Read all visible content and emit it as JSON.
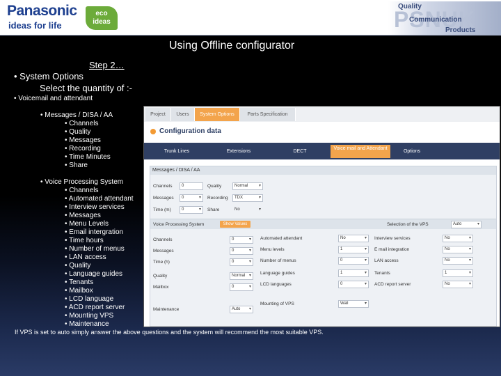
{
  "header": {
    "brand": "Panasonic",
    "tagline": "ideas for life",
    "eco_line1": "eco",
    "eco_line2": "ideas",
    "psnuk": "PSNUK",
    "quality": "Quality",
    "communication": "Communication",
    "products": "Products"
  },
  "title": "Using Offline configurator",
  "step": "Step 2…",
  "system_options": "• System Options",
  "select_quantity": "Select the quantity of :-",
  "voicemail_bullet": "•   Voicemail and attendant",
  "messages_bullet": "•   Messages / DISA / AA",
  "messages_items": [
    "Channels",
    "Quality",
    "Messages",
    "Recording",
    "Time Minutes",
    "Share"
  ],
  "vps_bullet": "•   Voice Processing System",
  "vps_items": [
    "Channels",
    "Automated attendant",
    "Interview services",
    "Messages",
    "Menu Levels",
    "Email intergration",
    "Time hours",
    "Number of menus",
    "LAN access",
    "Quality",
    "Language guides",
    "Tenants",
    "Mailbox",
    "LCD language",
    "ACD report server",
    "Mounting VPS",
    "Maintenance"
  ],
  "footer": "If VPS is set to auto simply answer the above questions and the system will recommend the most  suitable VPS.",
  "screenshot": {
    "tabs": [
      "Project",
      "Users",
      "System Options",
      "Parts Specification"
    ],
    "config_title": "Configuration data",
    "subtabs": [
      "Trunk Lines",
      "Extensions",
      "DECT",
      "Voice mail and Attendant",
      "Options"
    ],
    "msg_section": "Messages / DISA / AA",
    "msg_fields": {
      "channels_label": "Channels",
      "channels_value": "0",
      "quality_label": "Quality",
      "quality_value": "Normal",
      "messages_label": "Messages",
      "messages_value": "0",
      "recording_label": "Recording",
      "recording_value": "TDX",
      "time_label": "Time (m)",
      "time_value": "0",
      "share_label": "Share",
      "share_value": "No"
    },
    "vps_section": "Voice Processing System",
    "vps_button": "Show Values",
    "selection_label": "Selection of the VPS",
    "selection_value": "Auto",
    "vps_left": [
      {
        "label": "Channels",
        "value": "0"
      },
      {
        "label": "Messages",
        "value": "0"
      },
      {
        "label": "Time (h)",
        "value": "0"
      },
      {
        "label": "Quality",
        "value": "Normal"
      },
      {
        "label": "Mailbox",
        "value": "0"
      },
      {
        "label": "Maintenance",
        "value": "Auto"
      }
    ],
    "vps_mid": [
      {
        "label": "Automated attendant",
        "value": "No"
      },
      {
        "label": "Menu levels",
        "value": "1"
      },
      {
        "label": "Number of menus",
        "value": "0"
      },
      {
        "label": "Language guides",
        "value": "1"
      },
      {
        "label": "LCD languages",
        "value": "0"
      },
      {
        "label": "Mounting of VPS",
        "value": "Wall"
      }
    ],
    "vps_right": [
      {
        "label": "Interview services",
        "value": "No"
      },
      {
        "label": "E mail integration",
        "value": "No"
      },
      {
        "label": "LAN access",
        "value": "No"
      },
      {
        "label": "Tenants",
        "value": "1"
      },
      {
        "label": "ACD report server",
        "value": "No"
      }
    ]
  }
}
